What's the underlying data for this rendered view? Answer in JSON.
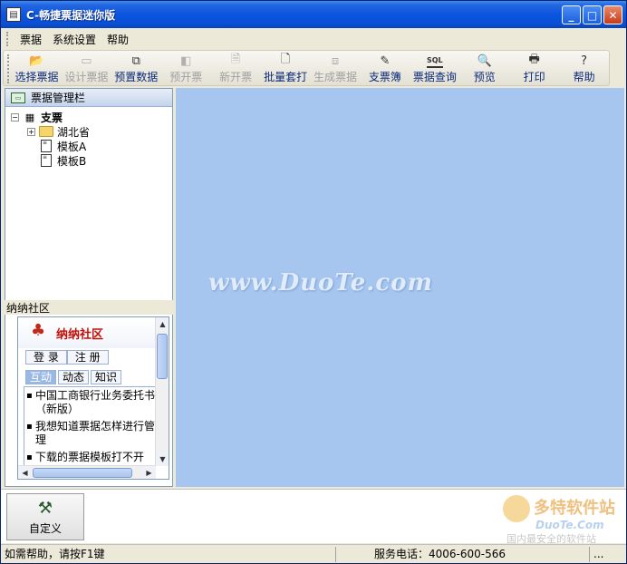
{
  "window": {
    "title": "C-畅捷票据迷你版",
    "controls": {
      "minimize": "_",
      "maximize": "□",
      "close": "✕"
    }
  },
  "menu": [
    "票据",
    "系统设置",
    "帮助"
  ],
  "toolbar": [
    {
      "label": "选择票据",
      "icon": "open-folder-icon",
      "enabled": true
    },
    {
      "label": "设计票据",
      "icon": "design-icon",
      "enabled": false
    },
    {
      "label": "预置数据",
      "icon": "preset-data-icon",
      "enabled": true
    },
    {
      "label": "预开票",
      "icon": "pre-invoice-icon",
      "enabled": false
    },
    {
      "label": "新开票",
      "icon": "new-invoice-icon",
      "enabled": false
    },
    {
      "label": "批量套打",
      "icon": "batch-print-icon",
      "enabled": true
    },
    {
      "label": "生成票据",
      "icon": "generate-icon",
      "enabled": false
    },
    {
      "label": "支票簿",
      "icon": "checkbook-icon",
      "enabled": true
    },
    {
      "label": "票据查询",
      "icon": "sql-icon",
      "enabled": true
    },
    {
      "label": "预览",
      "icon": "preview-icon",
      "enabled": true
    },
    {
      "label": "打印",
      "icon": "printer-icon",
      "enabled": true
    },
    {
      "label": "帮助",
      "icon": "help-icon",
      "enabled": true
    }
  ],
  "left_panel": {
    "header": "票据管理栏",
    "tree": {
      "root": "支票",
      "children": [
        {
          "label": "湖北省",
          "type": "folder",
          "collapsed": true
        },
        {
          "label": "模板A",
          "type": "document"
        },
        {
          "label": "模板B",
          "type": "document"
        }
      ]
    }
  },
  "community": {
    "section_label": "纳纳社区",
    "title": "纳纳社区",
    "login": "登 录",
    "register": "注 册",
    "tabs": [
      "互动",
      "动态",
      "知识"
    ],
    "news": [
      "中国工商银行业务委托书（新版）",
      "我想知道票据怎样进行管理",
      "下载的票据模板打不开"
    ]
  },
  "main": {
    "watermark": "www.DuoTe.com"
  },
  "bottom": {
    "custom_button": "自定义",
    "logo": {
      "line1": "多特软件站",
      "line2": "DuoTe.Com",
      "line3": "国内最安全的软件站"
    }
  },
  "status": {
    "help_hint": "如需帮助，请按F1键",
    "phone": "服务电话：4006-600-566",
    "extra": "..."
  },
  "colors": {
    "title_bar": "#0a55e0",
    "main_background": "#a6c6f0",
    "window_background": "#ece9d8"
  }
}
